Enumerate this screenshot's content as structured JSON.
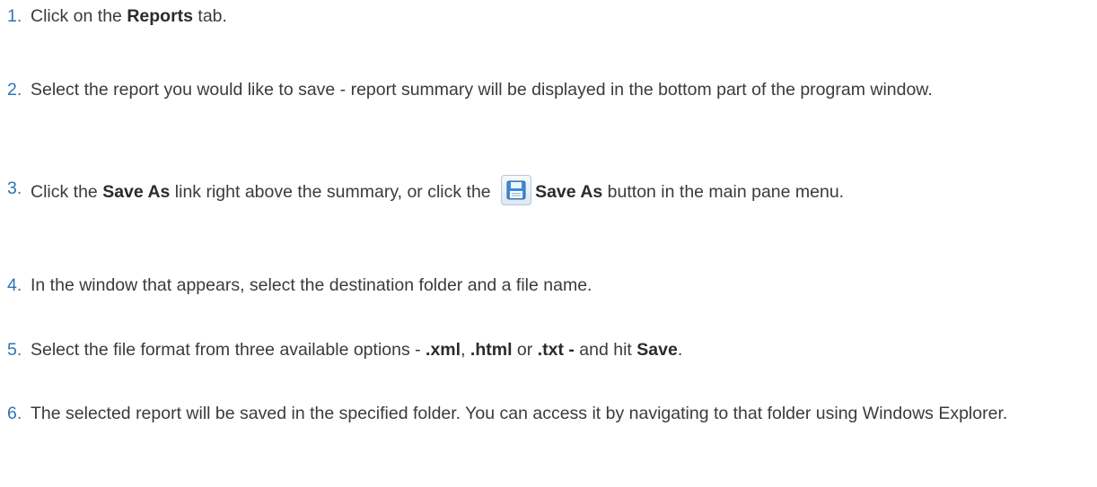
{
  "steps": [
    {
      "number": "1.",
      "parts": [
        "Click on the ",
        "Reports",
        " tab."
      ]
    },
    {
      "number": "2.",
      "parts": [
        "Select the report you would like to save - report summary will be displayed in the bottom part of the program window."
      ]
    },
    {
      "number": "3.",
      "parts": [
        "Click the ",
        "Save As",
        " link right above the summary, or click the ",
        "Save As",
        " button in the main pane menu."
      ],
      "icon": "floppy-disk-save-icon"
    },
    {
      "number": "4.",
      "parts": [
        "In the window that appears, select the destination folder and a file name."
      ]
    },
    {
      "number": "5.",
      "parts": [
        "Select the file format from three available options - ",
        ".xml",
        ", ",
        ".html",
        " or ",
        ".txt -",
        " and hit ",
        "Save",
        "."
      ]
    },
    {
      "number": "6.",
      "parts": [
        "The selected report will be saved in the specified folder. You can access it by navigating to that folder using Windows Explorer."
      ]
    }
  ],
  "colors": {
    "number": "#2e74b5",
    "text": "#3b3b3b",
    "icon_accent": "#2f7fd1"
  }
}
